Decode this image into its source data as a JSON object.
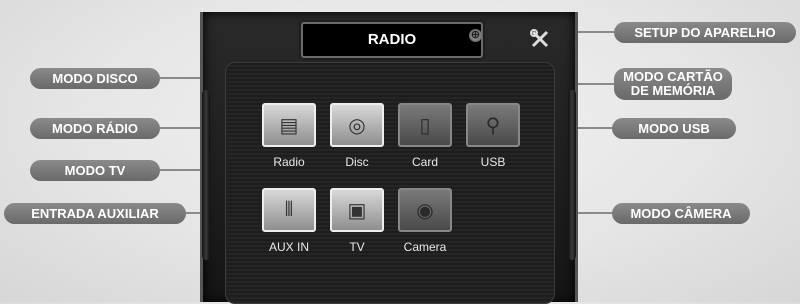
{
  "screen": {
    "title": "RADIO",
    "screw_glyph": "⊕",
    "setup_icon": "wrench-screwdriver-icon"
  },
  "apps": [
    {
      "label": "Radio",
      "icon": "radio-icon",
      "glyph": "▤",
      "state": "active"
    },
    {
      "label": "Disc",
      "icon": "disc-icon",
      "glyph": "◎",
      "state": "active"
    },
    {
      "label": "Card",
      "icon": "memory-card-icon",
      "glyph": "▯",
      "state": "dim"
    },
    {
      "label": "USB",
      "icon": "usb-icon",
      "glyph": "⚲",
      "state": "dim"
    },
    {
      "label": "AUX IN",
      "icon": "aux-in-icon",
      "glyph": "⫴",
      "state": "active"
    },
    {
      "label": "TV",
      "icon": "tv-icon",
      "glyph": "▣",
      "state": "active"
    },
    {
      "label": "Camera",
      "icon": "camera-icon",
      "glyph": "◉",
      "state": "dim"
    }
  ],
  "callouts": {
    "setup": "SETUP DO APARELHO",
    "disc": "MODO DISCO",
    "card_line1": "MODO CARTÃO",
    "card_line2": "DE MEMÓRIA",
    "radio": "MODO RÁDIO",
    "usb": "MODO USB",
    "tv": "MODO TV",
    "aux": "ENTRADA AUXILIAR",
    "camera": "MODO CÂMERA"
  },
  "colors": {
    "callout_bg": "#7a7a7a",
    "screen_bg": "#1a1a1a",
    "title_bg": "#000000"
  }
}
